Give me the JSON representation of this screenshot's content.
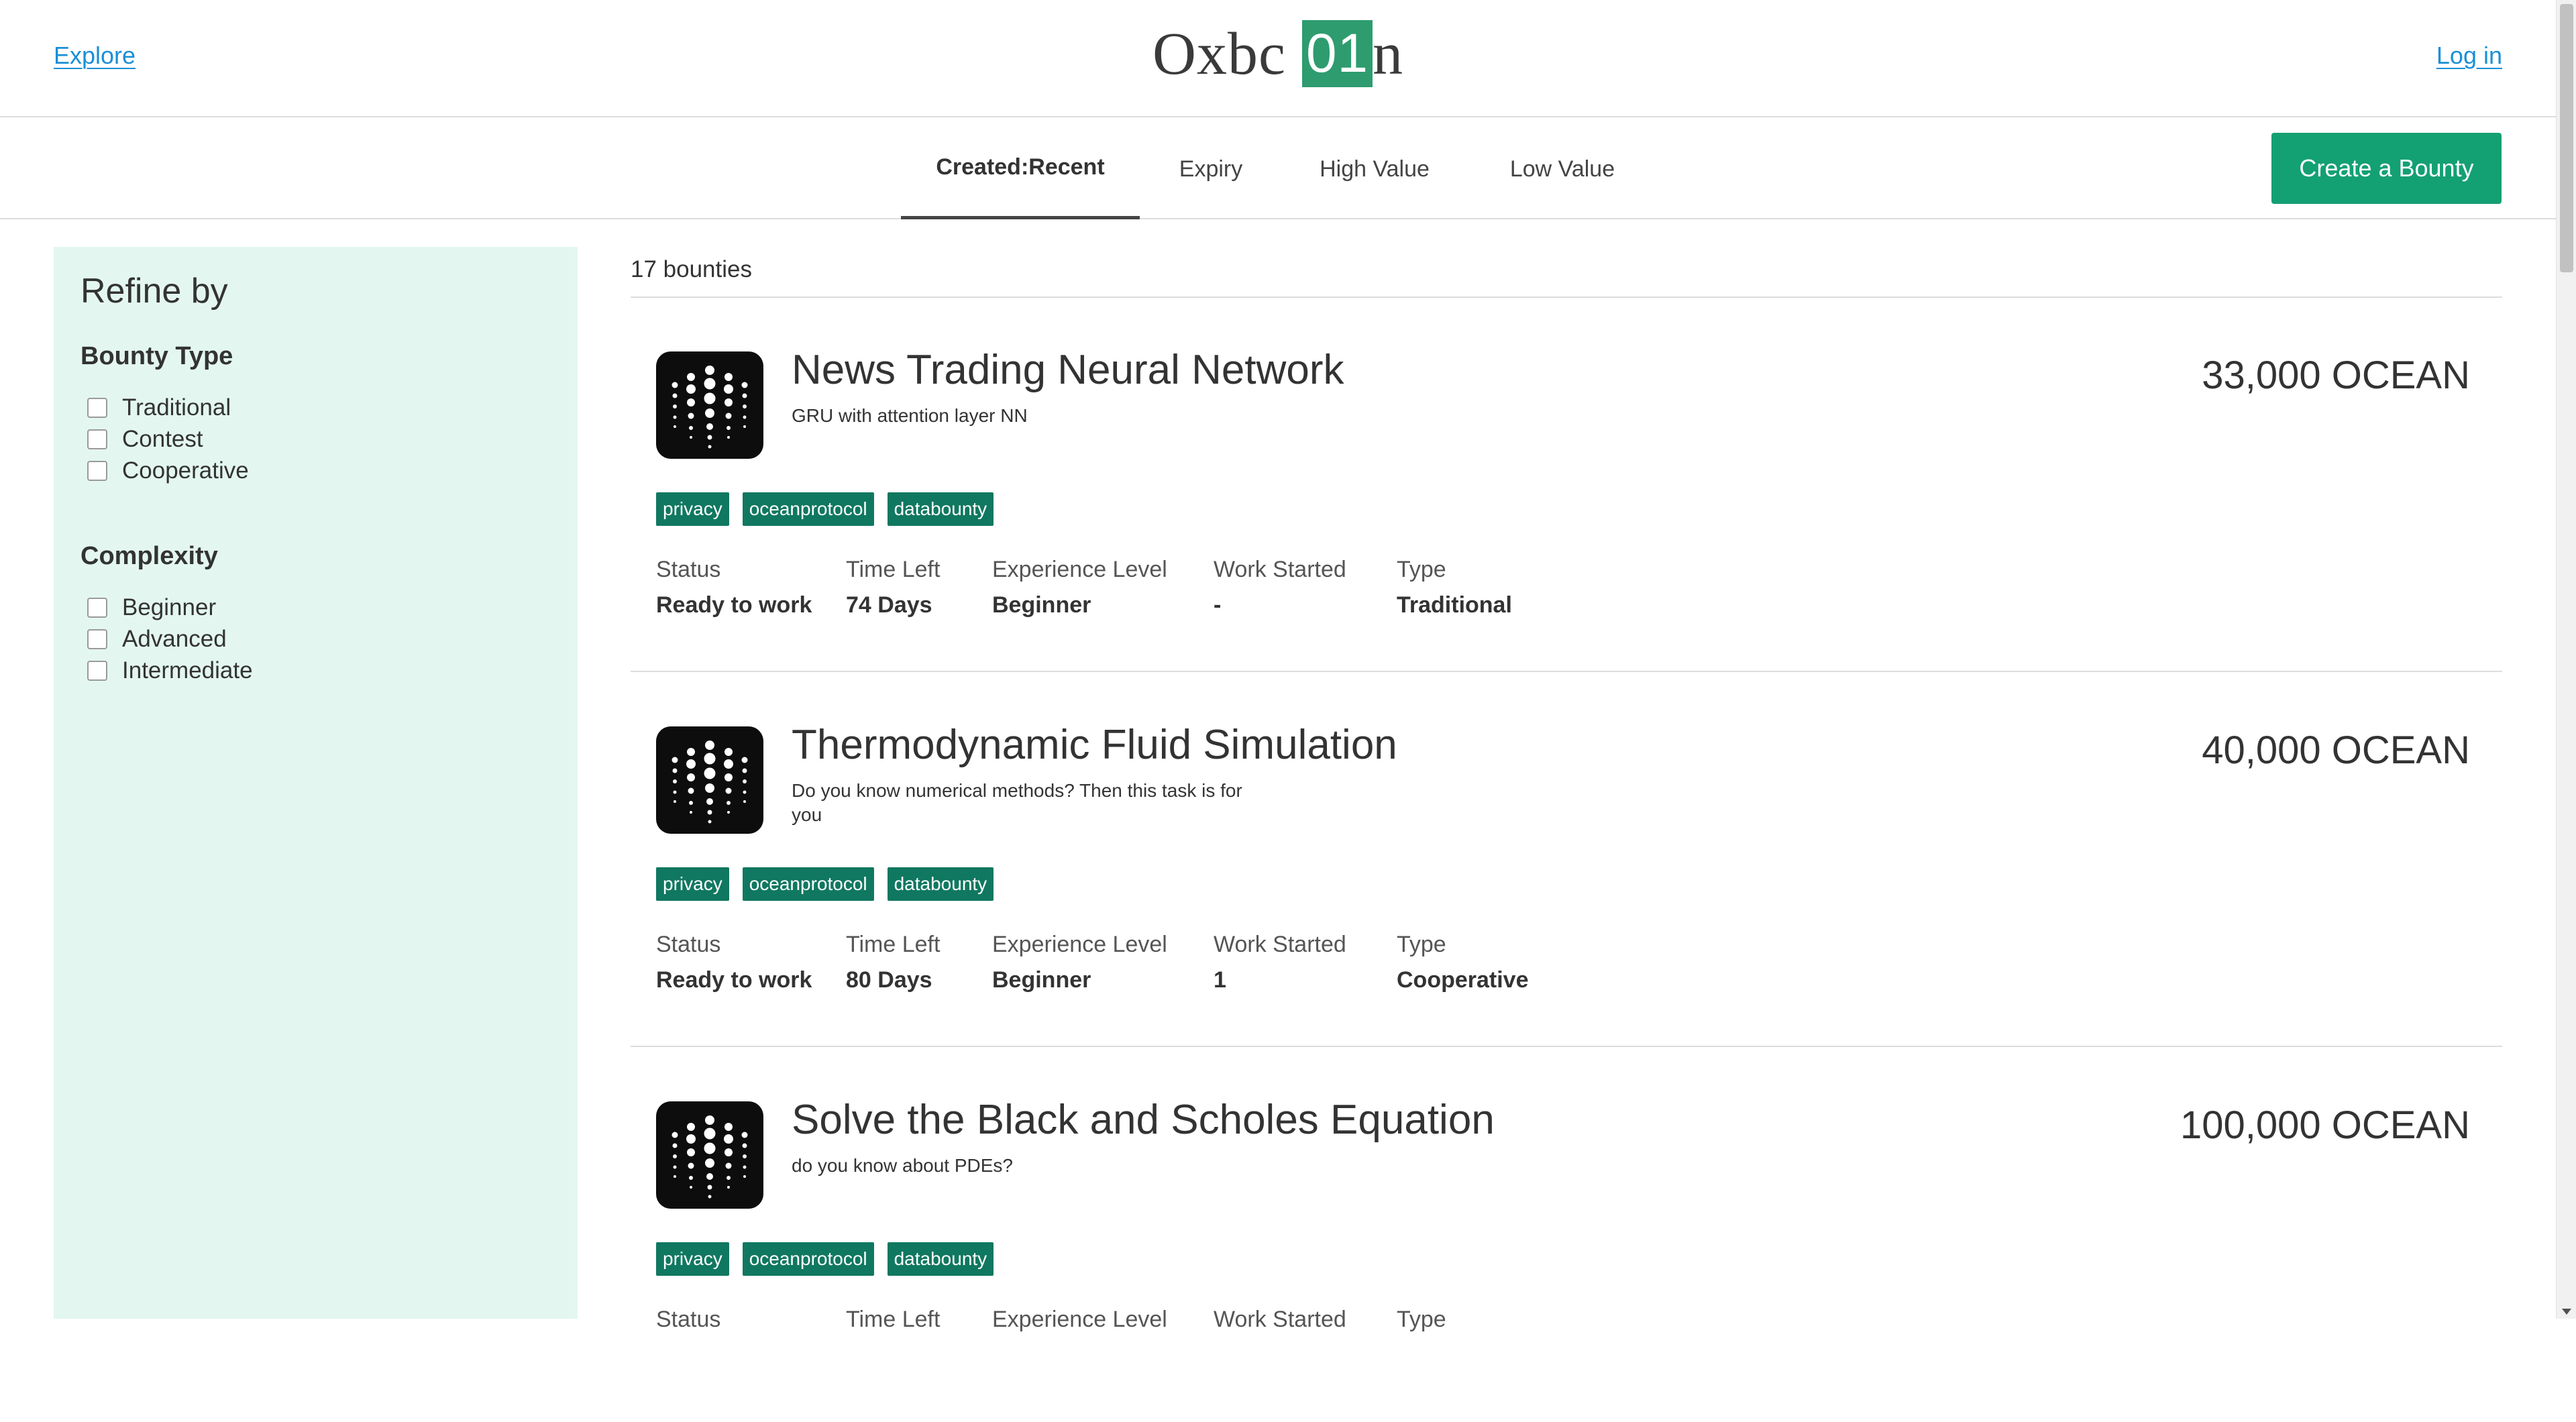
{
  "header": {
    "explore_label": "Explore",
    "logo_text": "Oxbc",
    "logo_box_text": "01",
    "logo_suffix": "n",
    "login_label": "Log in"
  },
  "sort_tabs": [
    {
      "label": "Created:Recent",
      "active": true
    },
    {
      "label": "Expiry",
      "active": false
    },
    {
      "label": "High Value",
      "active": false
    },
    {
      "label": "Low Value",
      "active": false
    }
  ],
  "create_bounty_label": "Create a Bounty",
  "sidebar": {
    "title": "Refine by",
    "bounty_type": {
      "title": "Bounty Type",
      "options": [
        "Traditional",
        "Contest",
        "Cooperative"
      ]
    },
    "complexity": {
      "title": "Complexity",
      "options": [
        "Beginner",
        "Advanced",
        "Intermediate"
      ]
    }
  },
  "results_count": "17 bounties",
  "meta_labels": {
    "status": "Status",
    "time_left": "Time Left",
    "experience": "Experience Level",
    "work_started": "Work Started",
    "type": "Type"
  },
  "bounties": [
    {
      "title": "News Trading Neural Network",
      "description": "GRU with attention layer NN",
      "reward": "33,000 OCEAN",
      "tags": [
        "privacy",
        "oceanprotocol",
        "databounty"
      ],
      "status": "Ready to work",
      "time_left": "74 Days",
      "experience": "Beginner",
      "work_started": "-",
      "type": "Traditional"
    },
    {
      "title": "Thermodynamic Fluid Simulation",
      "description": "Do you know numerical methods? Then this task is for you",
      "reward": "40,000 OCEAN",
      "tags": [
        "privacy",
        "oceanprotocol",
        "databounty"
      ],
      "status": "Ready to work",
      "time_left": "80 Days",
      "experience": "Beginner",
      "work_started": "1",
      "type": "Cooperative"
    },
    {
      "title": "Solve the Black and Scholes Equation",
      "description": "do you know about PDEs?",
      "reward": "100,000 OCEAN",
      "tags": [
        "privacy",
        "oceanprotocol",
        "databounty"
      ],
      "status": "",
      "time_left": "",
      "experience": "",
      "work_started": "",
      "type": ""
    }
  ],
  "colors": {
    "brand": "#2e9c6f",
    "button": "#13a073",
    "tag": "#107860",
    "link": "#1a8fd6",
    "sidebar_bg": "#e3f7f0"
  },
  "icons": {
    "bounty": "ocean-dots-icon"
  }
}
